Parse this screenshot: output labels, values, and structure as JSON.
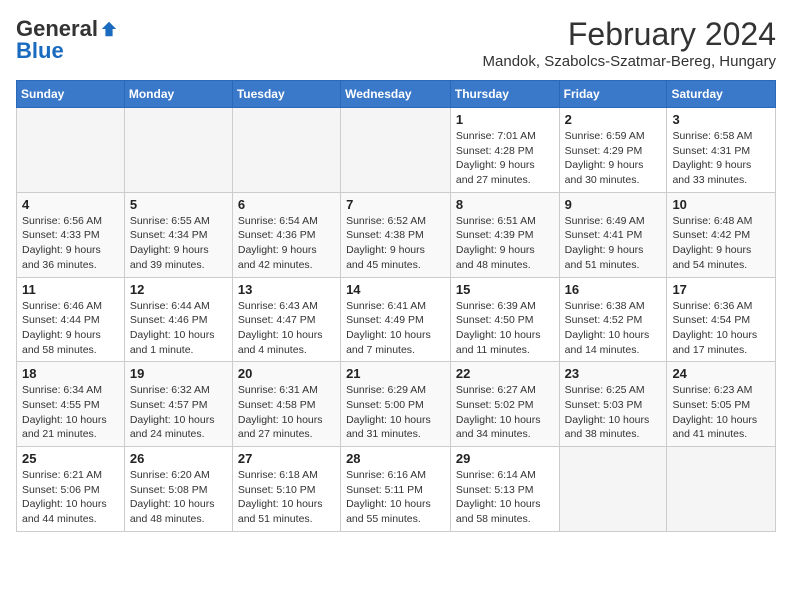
{
  "header": {
    "logo_general": "General",
    "logo_blue": "Blue",
    "month_title": "February 2024",
    "location": "Mandok, Szabolcs-Szatmar-Bereg, Hungary"
  },
  "days_of_week": [
    "Sunday",
    "Monday",
    "Tuesday",
    "Wednesday",
    "Thursday",
    "Friday",
    "Saturday"
  ],
  "weeks": [
    [
      {
        "day": "",
        "info": ""
      },
      {
        "day": "",
        "info": ""
      },
      {
        "day": "",
        "info": ""
      },
      {
        "day": "",
        "info": ""
      },
      {
        "day": "1",
        "info": "Sunrise: 7:01 AM\nSunset: 4:28 PM\nDaylight: 9 hours and 27 minutes."
      },
      {
        "day": "2",
        "info": "Sunrise: 6:59 AM\nSunset: 4:29 PM\nDaylight: 9 hours and 30 minutes."
      },
      {
        "day": "3",
        "info": "Sunrise: 6:58 AM\nSunset: 4:31 PM\nDaylight: 9 hours and 33 minutes."
      }
    ],
    [
      {
        "day": "4",
        "info": "Sunrise: 6:56 AM\nSunset: 4:33 PM\nDaylight: 9 hours and 36 minutes."
      },
      {
        "day": "5",
        "info": "Sunrise: 6:55 AM\nSunset: 4:34 PM\nDaylight: 9 hours and 39 minutes."
      },
      {
        "day": "6",
        "info": "Sunrise: 6:54 AM\nSunset: 4:36 PM\nDaylight: 9 hours and 42 minutes."
      },
      {
        "day": "7",
        "info": "Sunrise: 6:52 AM\nSunset: 4:38 PM\nDaylight: 9 hours and 45 minutes."
      },
      {
        "day": "8",
        "info": "Sunrise: 6:51 AM\nSunset: 4:39 PM\nDaylight: 9 hours and 48 minutes."
      },
      {
        "day": "9",
        "info": "Sunrise: 6:49 AM\nSunset: 4:41 PM\nDaylight: 9 hours and 51 minutes."
      },
      {
        "day": "10",
        "info": "Sunrise: 6:48 AM\nSunset: 4:42 PM\nDaylight: 9 hours and 54 minutes."
      }
    ],
    [
      {
        "day": "11",
        "info": "Sunrise: 6:46 AM\nSunset: 4:44 PM\nDaylight: 9 hours and 58 minutes."
      },
      {
        "day": "12",
        "info": "Sunrise: 6:44 AM\nSunset: 4:46 PM\nDaylight: 10 hours and 1 minute."
      },
      {
        "day": "13",
        "info": "Sunrise: 6:43 AM\nSunset: 4:47 PM\nDaylight: 10 hours and 4 minutes."
      },
      {
        "day": "14",
        "info": "Sunrise: 6:41 AM\nSunset: 4:49 PM\nDaylight: 10 hours and 7 minutes."
      },
      {
        "day": "15",
        "info": "Sunrise: 6:39 AM\nSunset: 4:50 PM\nDaylight: 10 hours and 11 minutes."
      },
      {
        "day": "16",
        "info": "Sunrise: 6:38 AM\nSunset: 4:52 PM\nDaylight: 10 hours and 14 minutes."
      },
      {
        "day": "17",
        "info": "Sunrise: 6:36 AM\nSunset: 4:54 PM\nDaylight: 10 hours and 17 minutes."
      }
    ],
    [
      {
        "day": "18",
        "info": "Sunrise: 6:34 AM\nSunset: 4:55 PM\nDaylight: 10 hours and 21 minutes."
      },
      {
        "day": "19",
        "info": "Sunrise: 6:32 AM\nSunset: 4:57 PM\nDaylight: 10 hours and 24 minutes."
      },
      {
        "day": "20",
        "info": "Sunrise: 6:31 AM\nSunset: 4:58 PM\nDaylight: 10 hours and 27 minutes."
      },
      {
        "day": "21",
        "info": "Sunrise: 6:29 AM\nSunset: 5:00 PM\nDaylight: 10 hours and 31 minutes."
      },
      {
        "day": "22",
        "info": "Sunrise: 6:27 AM\nSunset: 5:02 PM\nDaylight: 10 hours and 34 minutes."
      },
      {
        "day": "23",
        "info": "Sunrise: 6:25 AM\nSunset: 5:03 PM\nDaylight: 10 hours and 38 minutes."
      },
      {
        "day": "24",
        "info": "Sunrise: 6:23 AM\nSunset: 5:05 PM\nDaylight: 10 hours and 41 minutes."
      }
    ],
    [
      {
        "day": "25",
        "info": "Sunrise: 6:21 AM\nSunset: 5:06 PM\nDaylight: 10 hours and 44 minutes."
      },
      {
        "day": "26",
        "info": "Sunrise: 6:20 AM\nSunset: 5:08 PM\nDaylight: 10 hours and 48 minutes."
      },
      {
        "day": "27",
        "info": "Sunrise: 6:18 AM\nSunset: 5:10 PM\nDaylight: 10 hours and 51 minutes."
      },
      {
        "day": "28",
        "info": "Sunrise: 6:16 AM\nSunset: 5:11 PM\nDaylight: 10 hours and 55 minutes."
      },
      {
        "day": "29",
        "info": "Sunrise: 6:14 AM\nSunset: 5:13 PM\nDaylight: 10 hours and 58 minutes."
      },
      {
        "day": "",
        "info": ""
      },
      {
        "day": "",
        "info": ""
      }
    ]
  ]
}
